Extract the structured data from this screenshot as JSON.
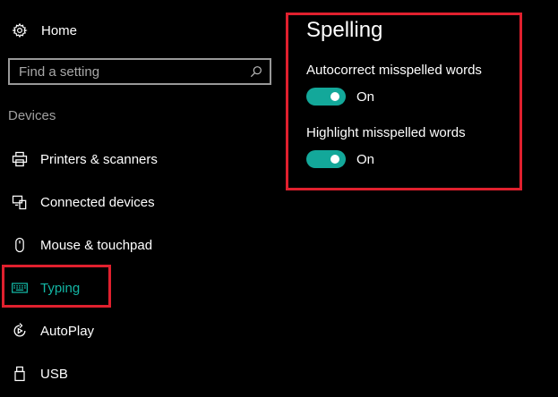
{
  "sidebar": {
    "home_label": "Home",
    "search": {
      "placeholder": "Find a setting",
      "value": ""
    },
    "section_title": "Devices",
    "items": [
      {
        "label": "Printers & scanners",
        "icon": "printer-icon"
      },
      {
        "label": "Connected devices",
        "icon": "connected-devices-icon"
      },
      {
        "label": "Mouse & touchpad",
        "icon": "mouse-icon"
      },
      {
        "label": "Typing",
        "icon": "keyboard-icon",
        "selected": true
      },
      {
        "label": "AutoPlay",
        "icon": "autoplay-icon"
      },
      {
        "label": "USB",
        "icon": "usb-icon"
      }
    ]
  },
  "main": {
    "section_title": "Spelling",
    "settings": [
      {
        "label": "Autocorrect misspelled words",
        "state": "On",
        "enabled": true
      },
      {
        "label": "Highlight misspelled words",
        "state": "On",
        "enabled": true
      }
    ]
  },
  "colors": {
    "background": "#000000",
    "accent": "#13a89a",
    "highlight_box": "#e0202e"
  }
}
